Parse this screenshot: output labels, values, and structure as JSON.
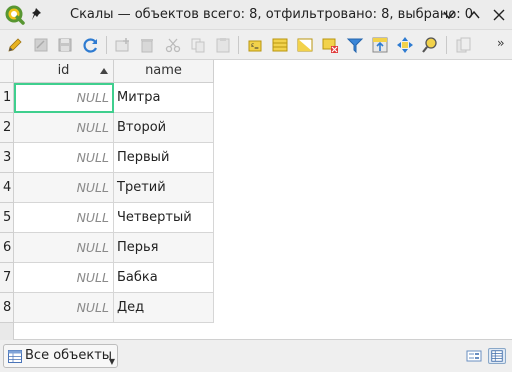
{
  "window": {
    "title": "Скалы — объектов всего: 8, отфильтровано: 8, выбрано: 0",
    "logo_icon": "qgis-logo-icon",
    "pin_icon": "pin-icon"
  },
  "toolbar": {
    "items": [
      {
        "name": "toggle-editing-icon",
        "enabled": true
      },
      {
        "name": "toggle-multi-edit-icon",
        "enabled": false
      },
      {
        "name": "save-edits-icon",
        "enabled": false
      },
      {
        "name": "reload-table-icon",
        "enabled": true
      },
      {
        "name": "add-feature-icon",
        "enabled": false
      },
      {
        "name": "delete-selected-icon",
        "enabled": false
      },
      {
        "name": "cut-selected-icon",
        "enabled": false
      },
      {
        "name": "copy-selected-icon",
        "enabled": false
      },
      {
        "name": "paste-features-icon",
        "enabled": false
      },
      {
        "name": "select-by-expression-icon",
        "enabled": true
      },
      {
        "name": "select-all-icon",
        "enabled": true
      },
      {
        "name": "invert-selection-icon",
        "enabled": true
      },
      {
        "name": "deselect-all-icon",
        "enabled": true
      },
      {
        "name": "filter-select-icon",
        "enabled": true
      },
      {
        "name": "move-selection-to-top-icon",
        "enabled": true
      },
      {
        "name": "pan-to-selected-icon",
        "enabled": true
      },
      {
        "name": "zoom-to-selected-icon",
        "enabled": true
      },
      {
        "name": "new-field-icon",
        "enabled": false
      }
    ],
    "overflow_label": "››"
  },
  "table": {
    "columns": [
      {
        "label": "id",
        "sorted": "ascending"
      },
      {
        "label": "name"
      }
    ],
    "rows": [
      {
        "num": "1",
        "id": "NULL",
        "name": "Митра"
      },
      {
        "num": "2",
        "id": "NULL",
        "name": "Второй"
      },
      {
        "num": "3",
        "id": "NULL",
        "name": "Первый"
      },
      {
        "num": "4",
        "id": "NULL",
        "name": "Третий"
      },
      {
        "num": "5",
        "id": "NULL",
        "name": "Четвертый"
      },
      {
        "num": "6",
        "id": "NULL",
        "name": "Перья"
      },
      {
        "num": "7",
        "id": "NULL",
        "name": "Бабка"
      },
      {
        "num": "8",
        "id": "NULL",
        "name": "Дед"
      }
    ],
    "current_cell": {
      "row": 1,
      "column": "id"
    },
    "current_cell_color": "#3fcf8e"
  },
  "bottom": {
    "filter_label": "Все объекты",
    "filter_icon": "table-filter-icon",
    "view_form_icon": "form-view-icon",
    "view_table_icon": "table-view-icon"
  }
}
